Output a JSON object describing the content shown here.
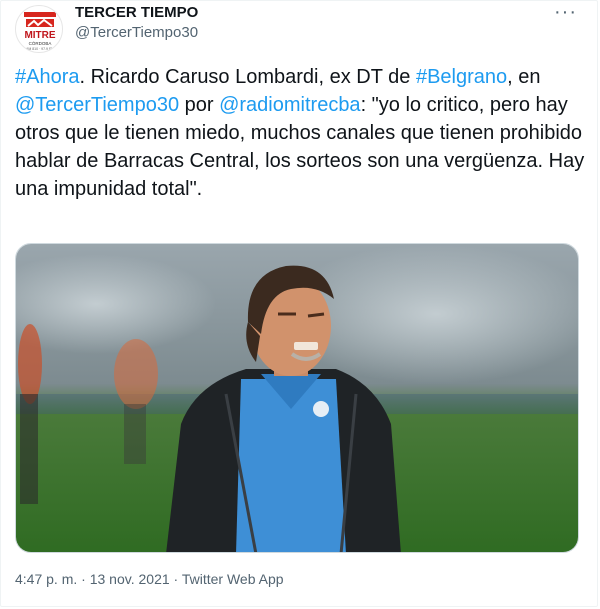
{
  "author": {
    "display_name": "TERCER TIEMPO",
    "handle": "@TercerTiempo30",
    "avatar_logo_text": "MITRE",
    "avatar_sub_text": "CÓRDOBA"
  },
  "more_icon": "more-horizontal-icon",
  "tweet": {
    "hashtag_ahora": "#Ahora",
    "t1": ". Ricardo Caruso Lombardi, ex DT de ",
    "hashtag_belgrano": "#Belgrano",
    "t2": ", en ",
    "mention_tt": "@TercerTiempo30",
    "t3": " por ",
    "mention_radio": "@radiomitrecba",
    "t4": ": \"yo lo critico, pero hay otros que le tienen miedo, muchos canales que tienen prohibido hablar de Barracas Central, los sorteos son una vergüenza. Hay una impunidad total\"."
  },
  "meta": {
    "time": "4:47 p. m.",
    "separator1": " · ",
    "date": "13 nov. 2021",
    "separator2": " · ",
    "app": "Twitter Web App"
  },
  "colors": {
    "link": "#1d9bf0",
    "text": "#0f1419",
    "secondary": "#536471"
  }
}
